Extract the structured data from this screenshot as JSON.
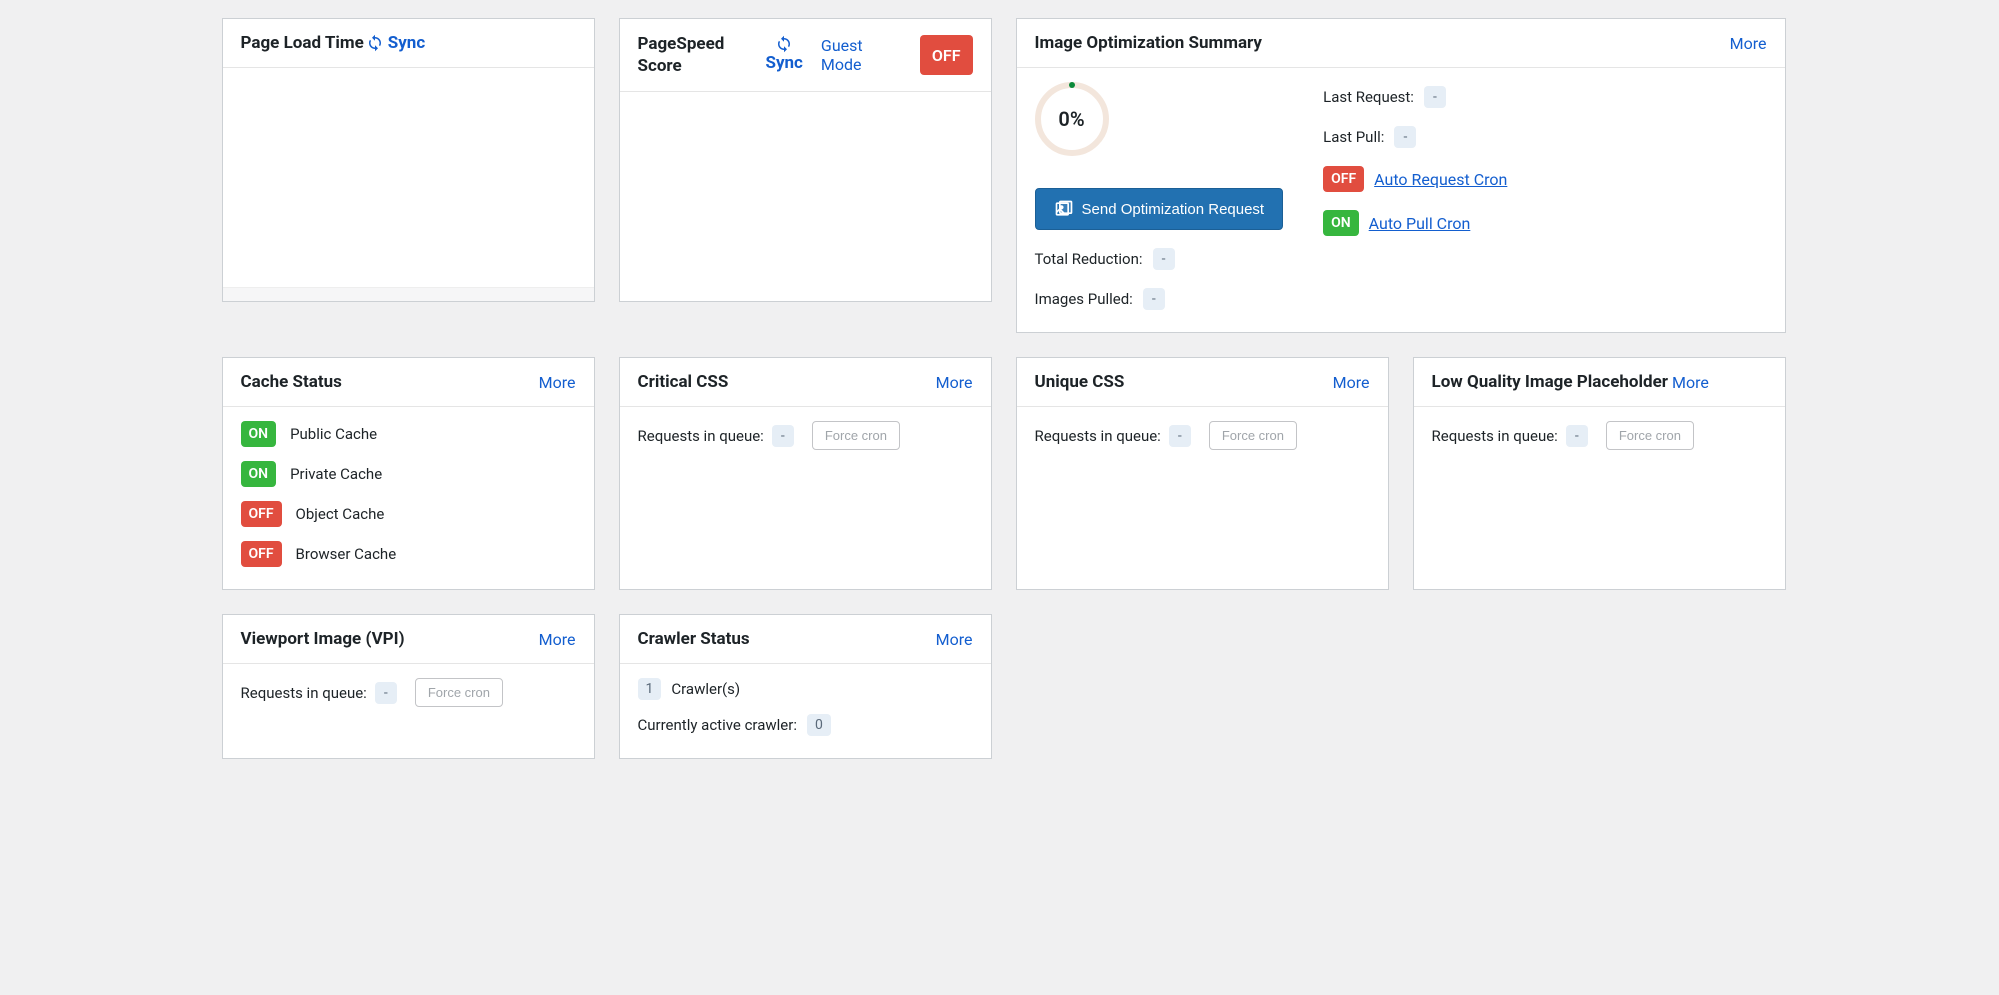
{
  "labels": {
    "more": "More",
    "sync": "Sync",
    "guest_mode": "Guest\nMode",
    "on": "ON",
    "off": "OFF",
    "requests_in_queue": "Requests in queue:",
    "force_cron": "Force cron",
    "dash": "-"
  },
  "cards": {
    "page_load": {
      "title": "Page Load Time"
    },
    "pagespeed": {
      "title": "PageSpeed Score",
      "status": "OFF"
    },
    "img_opt": {
      "title": "Image Optimization Summary",
      "percent": "0%",
      "send_btn": "Send Optimization Request",
      "total_reduction_label": "Total Reduction:",
      "images_pulled_label": "Images Pulled:",
      "last_request_label": "Last Request:",
      "last_pull_label": "Last Pull:",
      "auto_request_cron": "Auto Request Cron",
      "auto_pull_cron": "Auto Pull Cron",
      "auto_request_status": "OFF",
      "auto_pull_status": "ON"
    },
    "cache_status": {
      "title": "Cache Status",
      "items": [
        {
          "status": "ON",
          "label": "Public Cache"
        },
        {
          "status": "ON",
          "label": "Private Cache"
        },
        {
          "status": "OFF",
          "label": "Object Cache"
        },
        {
          "status": "OFF",
          "label": "Browser Cache"
        }
      ]
    },
    "critical_css": {
      "title": "Critical CSS"
    },
    "unique_css": {
      "title": "Unique CSS"
    },
    "lqip": {
      "title": "Low Quality Image Placeholder"
    },
    "vpi": {
      "title": "Viewport Image (VPI)"
    },
    "crawler": {
      "title": "Crawler Status",
      "crawler_count": "1",
      "crawler_label": "Crawler(s)",
      "active_label": "Currently active crawler:",
      "active_value": "0"
    }
  }
}
